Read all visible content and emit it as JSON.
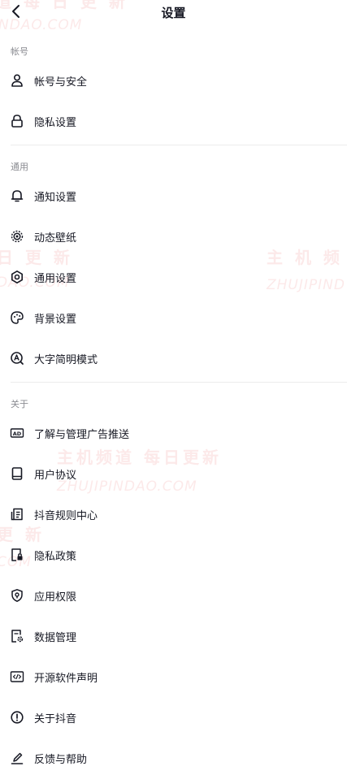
{
  "header": {
    "title": "设置"
  },
  "sections": {
    "account": {
      "label": "帐号",
      "items": [
        {
          "label": "帐号与安全",
          "icon": "person-icon"
        },
        {
          "label": "隐私设置",
          "icon": "lock-icon"
        }
      ]
    },
    "general": {
      "label": "通用",
      "items": [
        {
          "label": "通知设置",
          "icon": "bell-icon"
        },
        {
          "label": "动态壁纸",
          "icon": "dynamic-wallpaper-icon"
        },
        {
          "label": "通用设置",
          "icon": "gear-icon"
        },
        {
          "label": "背景设置",
          "icon": "palette-icon"
        },
        {
          "label": "大字简明模式",
          "icon": "large-font-icon"
        }
      ]
    },
    "about": {
      "label": "关于",
      "items": [
        {
          "label": "了解与管理广告推送",
          "icon": "ad-icon"
        },
        {
          "label": "用户协议",
          "icon": "book-icon"
        },
        {
          "label": "抖音规则中心",
          "icon": "rules-doc-icon"
        },
        {
          "label": "隐私政策",
          "icon": "privacy-policy-icon"
        },
        {
          "label": "应用权限",
          "icon": "shield-icon"
        },
        {
          "label": "数据管理",
          "icon": "data-management-icon"
        },
        {
          "label": "开源软件声明",
          "icon": "code-icon"
        },
        {
          "label": "关于抖音",
          "icon": "info-icon"
        },
        {
          "label": "反馈与帮助",
          "icon": "pencil-icon"
        }
      ]
    }
  },
  "watermark": {
    "cn_text": "主机频道 每日更新",
    "en_text": "ZHUJIPINDAO.COM",
    "cn_partial_top": "道 每 日 更 新",
    "en_partial_top": "NDAO.COM",
    "cn_partial_left": "日 更 新",
    "en_partial_left": "DAO.COM",
    "cn_partial_right": "主 机 频 道",
    "en_partial_right": "ZHUJIPIND",
    "cn_partial_left2": "更 新",
    "en_partial_left2": "COM"
  },
  "colors": {
    "text": "#161823",
    "muted": "#8a8b91",
    "divider": "#ececec",
    "background": "#ffffff"
  }
}
